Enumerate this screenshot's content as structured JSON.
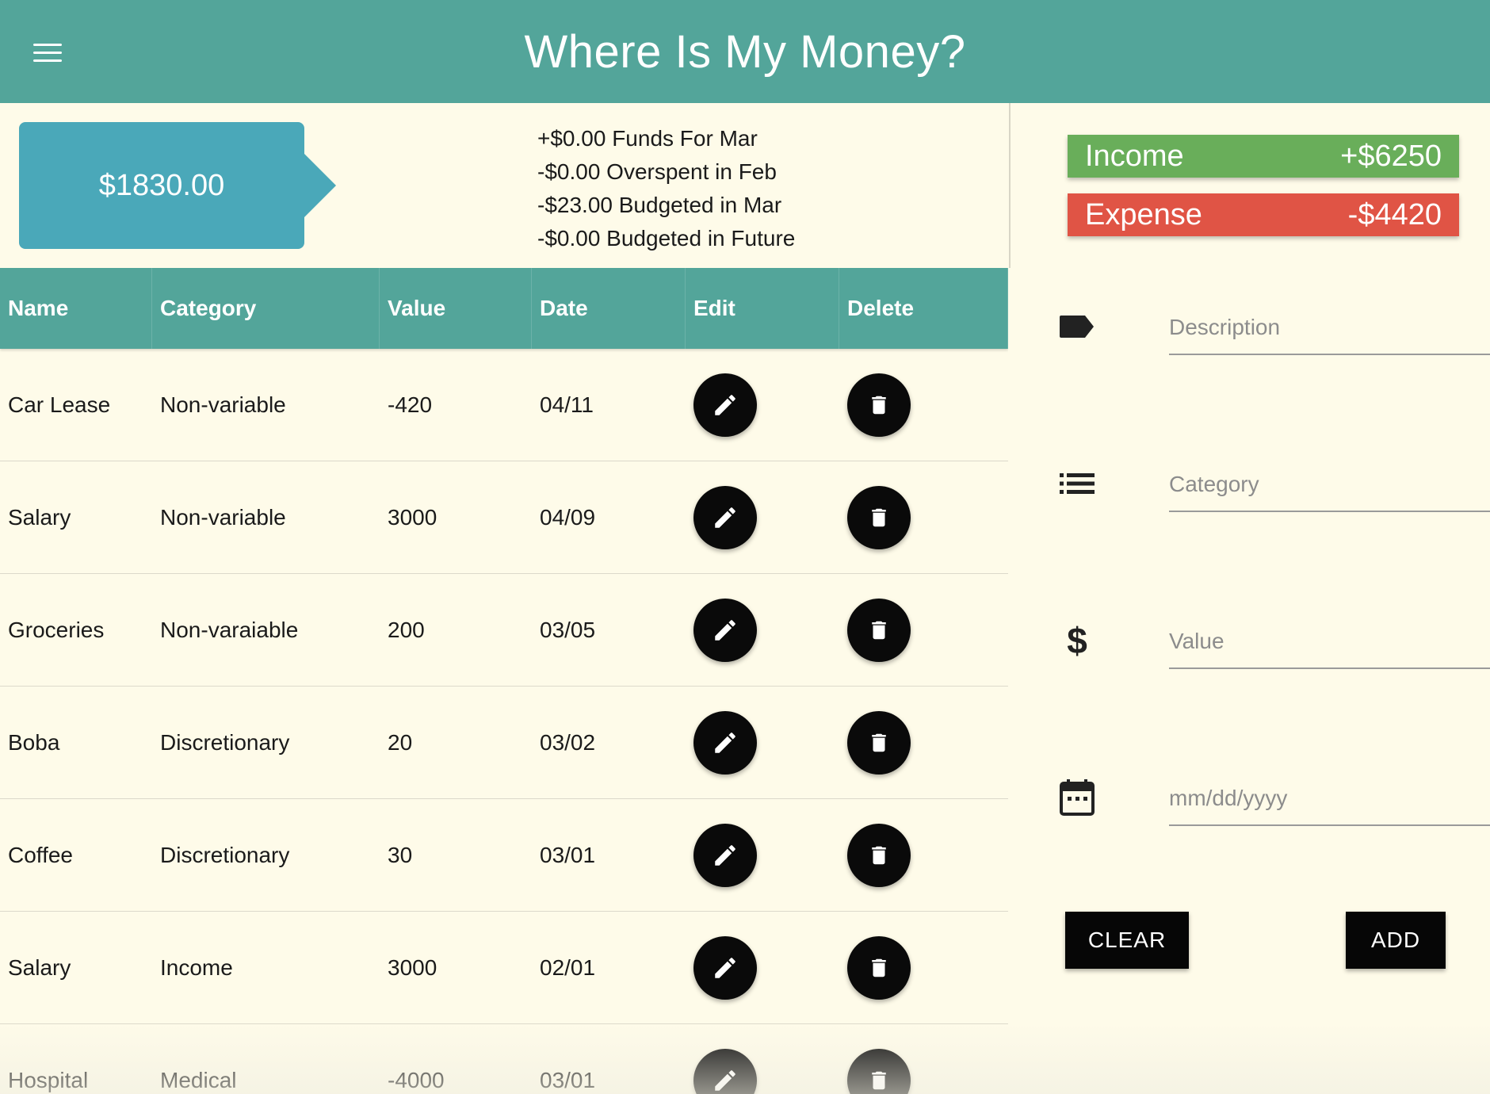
{
  "header": {
    "title": "Where Is My Money?",
    "menu_icon": "hamburger-icon"
  },
  "summary": {
    "balance": "$1830.00",
    "lines": [
      "+$0.00 Funds For Mar",
      "-$0.00 Overspent in Feb",
      "-$23.00 Budgeted in Mar",
      "-$0.00 Budgeted in Future"
    ]
  },
  "table": {
    "headers": [
      "Name",
      "Category",
      "Value",
      "Date",
      "Edit",
      "Delete"
    ],
    "rows": [
      {
        "name": "Car Lease",
        "category": "Non-variable",
        "value": "-420",
        "date": "04/11"
      },
      {
        "name": "Salary",
        "category": "Non-variable",
        "value": "3000",
        "date": "04/09"
      },
      {
        "name": "Groceries",
        "category": "Non-varaiable",
        "value": "200",
        "date": "03/05"
      },
      {
        "name": "Boba",
        "category": "Discretionary",
        "value": "20",
        "date": "03/02"
      },
      {
        "name": "Coffee",
        "category": "Discretionary",
        "value": "30",
        "date": "03/01"
      },
      {
        "name": "Salary",
        "category": "Income",
        "value": "3000",
        "date": "02/01"
      },
      {
        "name": "Hospital",
        "category": "Medical",
        "value": "-4000",
        "date": "03/01"
      }
    ]
  },
  "totals": {
    "income_label": "Income",
    "income_value": "+$6250",
    "expense_label": "Expense",
    "expense_value": "-$4420"
  },
  "form": {
    "description_placeholder": "Description",
    "category_placeholder": "Category",
    "value_placeholder": "Value",
    "date_placeholder": "mm/dd/yyyy",
    "clear_label": "CLEAR",
    "add_label": "ADD"
  },
  "colors": {
    "header": "#53a59a",
    "background": "#fefbe9",
    "balance": "#4aa8b9",
    "income": "#69ae5a",
    "expense": "#e05445",
    "button": "#060606"
  }
}
